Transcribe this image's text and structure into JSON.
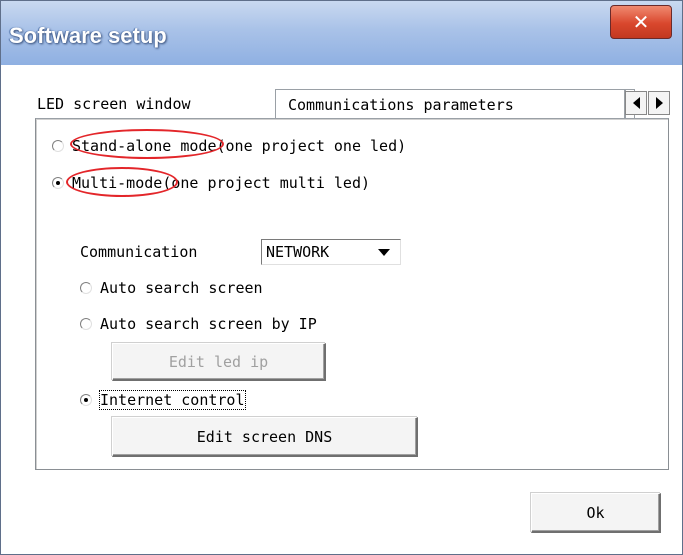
{
  "window": {
    "title": "Software setup",
    "close_icon": "close-icon"
  },
  "tabs": [
    {
      "label": "LED screen window"
    },
    {
      "label": "Communications parameters"
    },
    {
      "label": "."
    }
  ],
  "mode": {
    "standalone": {
      "label": "Stand-alone mode",
      "suffix": "(one project one led)",
      "checked": false
    },
    "multi": {
      "label": "Multi-mode",
      "suffix": "(one project multi led)",
      "checked": true
    }
  },
  "communication": {
    "label": "Communication",
    "value": "NETWORK"
  },
  "options": [
    {
      "label": "Auto search screen",
      "checked": false
    },
    {
      "label": "Auto search screen by IP",
      "checked": false
    },
    {
      "label": "Internet control",
      "checked": true
    }
  ],
  "buttons": {
    "edit_led_ip": "Edit led ip",
    "edit_screen_dns": "Edit screen DNS",
    "ok": "Ok"
  },
  "colors": {
    "annotation": "#e3262a",
    "title_gradient_end": "#8fb0e2",
    "close_red": "#d9472d"
  }
}
